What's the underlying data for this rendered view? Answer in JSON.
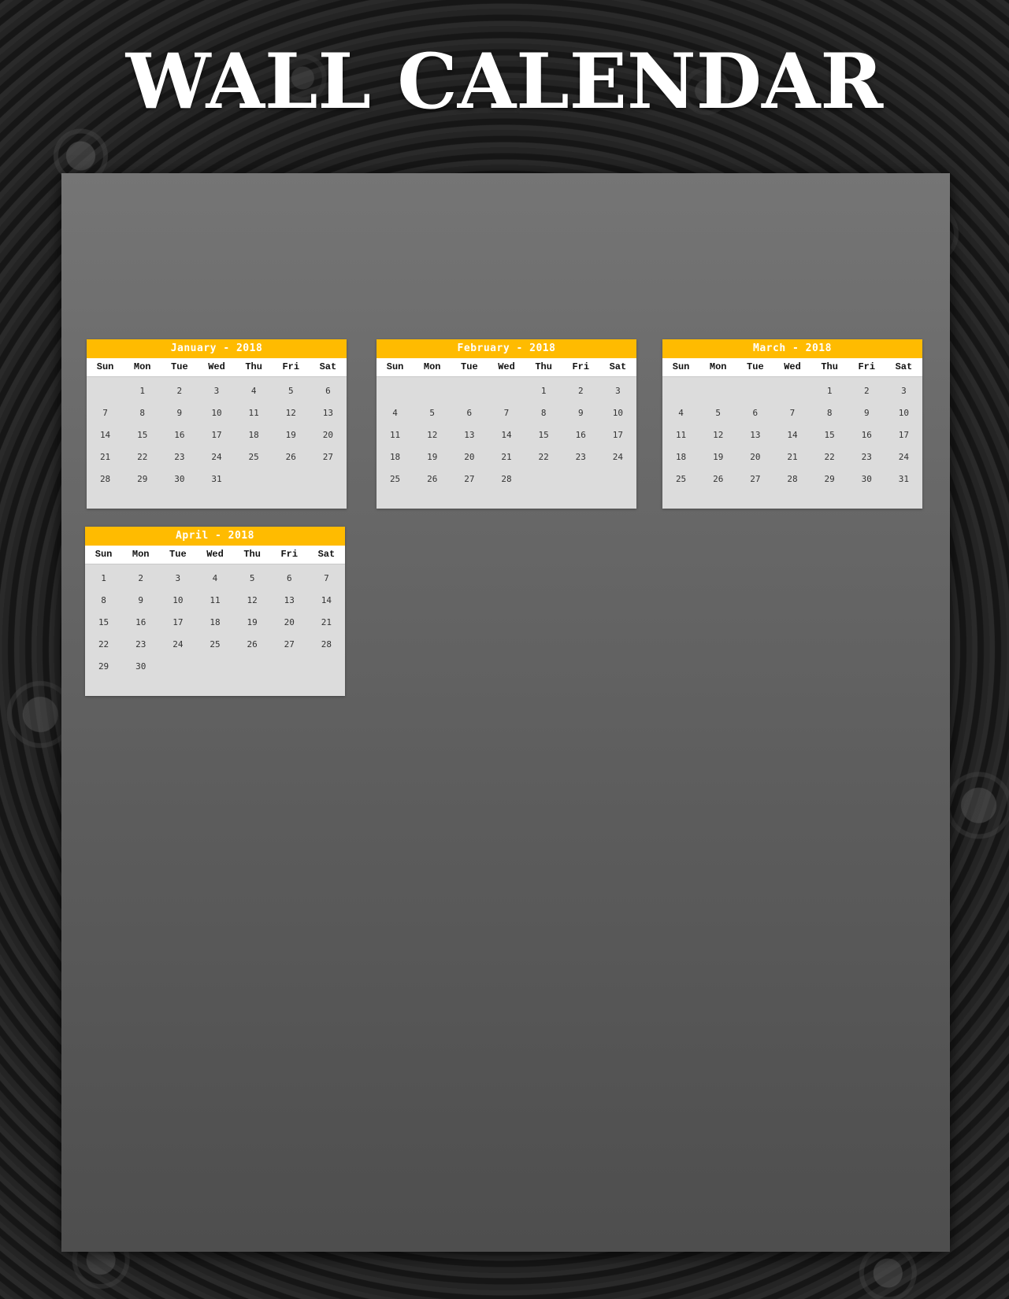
{
  "title": "WALL CALENDAR",
  "colors": {
    "accent": "#ffbb00",
    "sheet": "#6a6a6a",
    "calendar_body": "#dcdcdc"
  },
  "weekdays": [
    "Sun",
    "Mon",
    "Tue",
    "Wed",
    "Thu",
    "Fri",
    "Sat"
  ],
  "months": [
    {
      "label": "January - 2018",
      "weeks": [
        [
          "",
          "1",
          "2",
          "3",
          "4",
          "5",
          "6"
        ],
        [
          "7",
          "8",
          "9",
          "10",
          "11",
          "12",
          "13"
        ],
        [
          "14",
          "15",
          "16",
          "17",
          "18",
          "19",
          "20"
        ],
        [
          "21",
          "22",
          "23",
          "24",
          "25",
          "26",
          "27"
        ],
        [
          "28",
          "29",
          "30",
          "31",
          "",
          "",
          ""
        ]
      ]
    },
    {
      "label": "February - 2018",
      "weeks": [
        [
          "",
          "",
          "",
          "",
          "1",
          "2",
          "3"
        ],
        [
          "4",
          "5",
          "6",
          "7",
          "8",
          "9",
          "10"
        ],
        [
          "11",
          "12",
          "13",
          "14",
          "15",
          "16",
          "17"
        ],
        [
          "18",
          "19",
          "20",
          "21",
          "22",
          "23",
          "24"
        ],
        [
          "25",
          "26",
          "27",
          "28",
          "",
          "",
          ""
        ]
      ]
    },
    {
      "label": "March - 2018",
      "weeks": [
        [
          "",
          "",
          "",
          "",
          "1",
          "2",
          "3"
        ],
        [
          "4",
          "5",
          "6",
          "7",
          "8",
          "9",
          "10"
        ],
        [
          "11",
          "12",
          "13",
          "14",
          "15",
          "16",
          "17"
        ],
        [
          "18",
          "19",
          "20",
          "21",
          "22",
          "23",
          "24"
        ],
        [
          "25",
          "26",
          "27",
          "28",
          "29",
          "30",
          "31"
        ]
      ]
    },
    {
      "label": "April - 2018",
      "weeks": [
        [
          "1",
          "2",
          "3",
          "4",
          "5",
          "6",
          "7"
        ],
        [
          "8",
          "9",
          "10",
          "11",
          "12",
          "13",
          "14"
        ],
        [
          "15",
          "16",
          "17",
          "18",
          "19",
          "20",
          "21"
        ],
        [
          "22",
          "23",
          "24",
          "25",
          "26",
          "27",
          "28"
        ],
        [
          "29",
          "30",
          "",
          "",
          "",
          "",
          ""
        ]
      ]
    }
  ]
}
